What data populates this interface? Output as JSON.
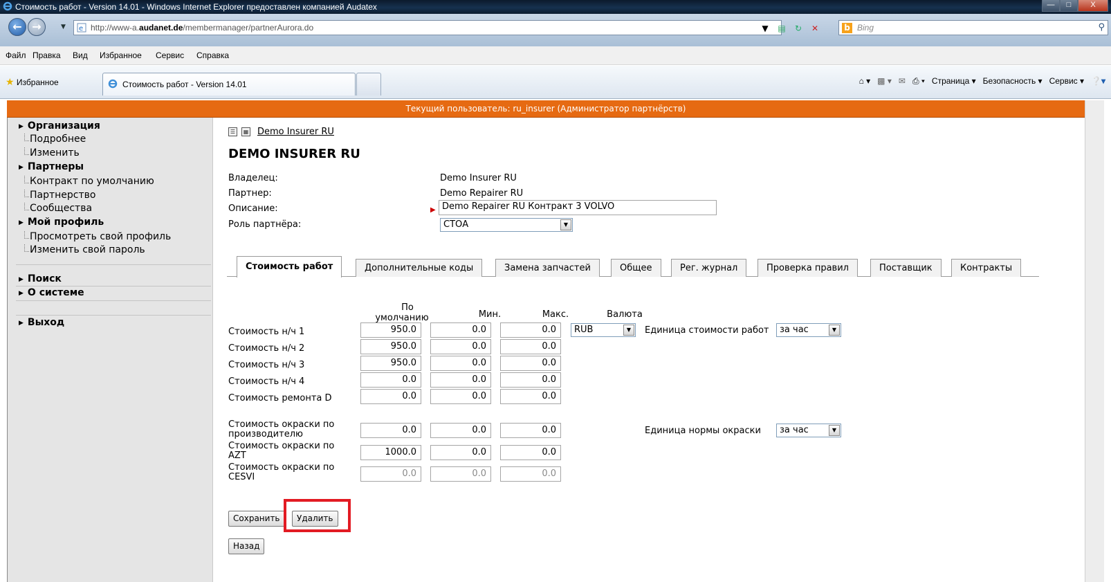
{
  "window": {
    "title": "Стоимость работ - Version 14.01 - Windows Internet Explorer предоставлен компанией Audatex",
    "url_prefix": "http://www-a.",
    "url_domain": "audanet.de",
    "url_path": "/membermanager/partnerAurora.do",
    "search_placeholder": "Bing"
  },
  "menu": [
    "Файл",
    "Правка",
    "Вид",
    "Избранное",
    "Сервис",
    "Справка"
  ],
  "favbar": {
    "favorites_label": "Избранное",
    "tab_label": "Стоимость работ - Version 14.01",
    "page_menu": "Страница ▾",
    "safety_menu": "Безопасность ▾",
    "tools_menu": "Сервис ▾"
  },
  "banner": "Текущий пользователь: ru_insurer  (Администратор партнёрств)",
  "sidebar": {
    "org": "Организация",
    "org_details": "Подробнее",
    "org_edit": "Изменить",
    "partners": "Партнеры",
    "default_contract": "Контракт по умолчанию",
    "partnership": "Партнерство",
    "communities": "Сообщества",
    "profile": "Мой профиль",
    "view_profile": "Просмотреть свой профиль",
    "change_password": "Изменить свой пароль",
    "search": "Поиск",
    "about": "О системе",
    "logout": "Выход"
  },
  "main": {
    "breadcrumb": "Demo Insurer RU",
    "title": "DEMO INSURER RU",
    "owner_label": "Владелец:",
    "owner_value": "Demo Insurer RU",
    "partner_label": "Партнер:",
    "partner_value": "Demo Repairer RU",
    "description_label": "Описание:",
    "description_value": "Demo Repairer RU Контракт 3 VOLVO",
    "role_label": "Роль партнёра:",
    "role_value": "СТОА"
  },
  "tabs": [
    "Стоимость работ",
    "Дополнительные коды",
    "Замена запчастей",
    "Общее",
    "Рег. журнал",
    "Проверка правил",
    "Поставщик",
    "Контракты"
  ],
  "rates": {
    "col_default_1": "По",
    "col_default_2": "умолчанию",
    "col_min": "Мин.",
    "col_max": "Макс.",
    "col_currency": "Валюта",
    "currency": "RUB",
    "labor_unit_label": "Единица стоимости работ",
    "labor_unit_value": "за час",
    "paint_unit_label": "Единица нормы окраски",
    "paint_unit_value": "за час",
    "rows": [
      {
        "label": "Стоимость н/ч 1",
        "def": "950.0",
        "min": "0.0",
        "max": "0.0"
      },
      {
        "label": "Стоимость н/ч 2",
        "def": "950.0",
        "min": "0.0",
        "max": "0.0"
      },
      {
        "label": "Стоимость н/ч 3",
        "def": "950.0",
        "min": "0.0",
        "max": "0.0"
      },
      {
        "label": "Стоимость н/ч 4",
        "def": "0.0",
        "min": "0.0",
        "max": "0.0"
      },
      {
        "label": "Стоимость ремонта D",
        "def": "0.0",
        "min": "0.0",
        "max": "0.0"
      }
    ],
    "paint_rows": [
      {
        "label1": "Стоимость окраски по",
        "label2": "производителю",
        "def": "0.0",
        "min": "0.0",
        "max": "0.0"
      },
      {
        "label1": "Стоимость окраски по",
        "label2": "AZT",
        "def": "1000.0",
        "min": "0.0",
        "max": "0.0"
      },
      {
        "label1": "Стоимость окраски по",
        "label2": "CESVI",
        "def": "0.0",
        "min": "0.0",
        "max": "0.0"
      }
    ]
  },
  "buttons": {
    "save": "Сохранить",
    "delete": "Удалить",
    "back": "Назад"
  },
  "colors": {
    "banner": "#e66a12",
    "highlight": "#e21b23"
  }
}
